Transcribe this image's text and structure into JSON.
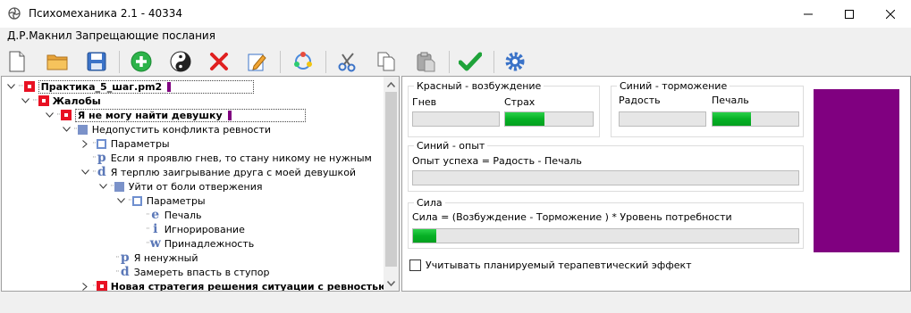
{
  "window": {
    "title": "Психомеханика 2.1 - 40334",
    "subtitle": "Д.Р.Макнил Запрещающие послания"
  },
  "toolbar": {
    "buttons": [
      "new-file-icon",
      "open-folder-icon",
      "save-icon",
      "add-icon",
      "yin-yang-icon",
      "delete-icon",
      "edit-icon",
      "refresh-icon",
      "cut-icon",
      "copy-icon",
      "paste-icon",
      "apply-icon",
      "settings-icon"
    ]
  },
  "tree": {
    "root": "Практика_5_шаг.pm2",
    "complaints": "Жалобы",
    "problem": "Я не могу найти девушку",
    "node1": "Недопустить конфликта ревности",
    "params1": "Параметры",
    "p_leaf": "Если я проявлю гнев, то стану никому не нужным",
    "d_node": "Я терплю заигрывание друга с моей девушкой",
    "avoid": "Уйти от боли отвержения",
    "params2": "Параметры",
    "e_leaf": "Печаль",
    "i_leaf": "Игнорирование",
    "w_leaf": "Принадлежность",
    "p2_leaf": "Я ненужный",
    "d2_leaf": "Замереть впасть в ступор",
    "new_strategy": "Новая стратегия решения ситуации с ревностью",
    "letters": {
      "p": "p",
      "d": "d",
      "e": "e",
      "i": "i",
      "w": "w"
    }
  },
  "panel": {
    "red_group": {
      "title": "Красный - возбуждение",
      "label1": "Гнев",
      "label2": "Страх",
      "value1": 0,
      "value2": 0.45
    },
    "blue_group": {
      "title": "Синий - торможение",
      "label1": "Радость",
      "label2": "Печаль",
      "value1": 0,
      "value2": 0.45
    },
    "experience_group": {
      "title": "Синий - опыт",
      "formula": "Опыт успеха = Радость - Печаль",
      "value": 0
    },
    "strength_group": {
      "title": "Сила",
      "formula": "Сила = (Возбуждение - Торможение ) * Уровень потребности",
      "value": 0.06
    },
    "checkbox_label": "Учитывать планируемый терапевтический  эффект",
    "checkbox_checked": false,
    "color_swatch": "#800080"
  }
}
